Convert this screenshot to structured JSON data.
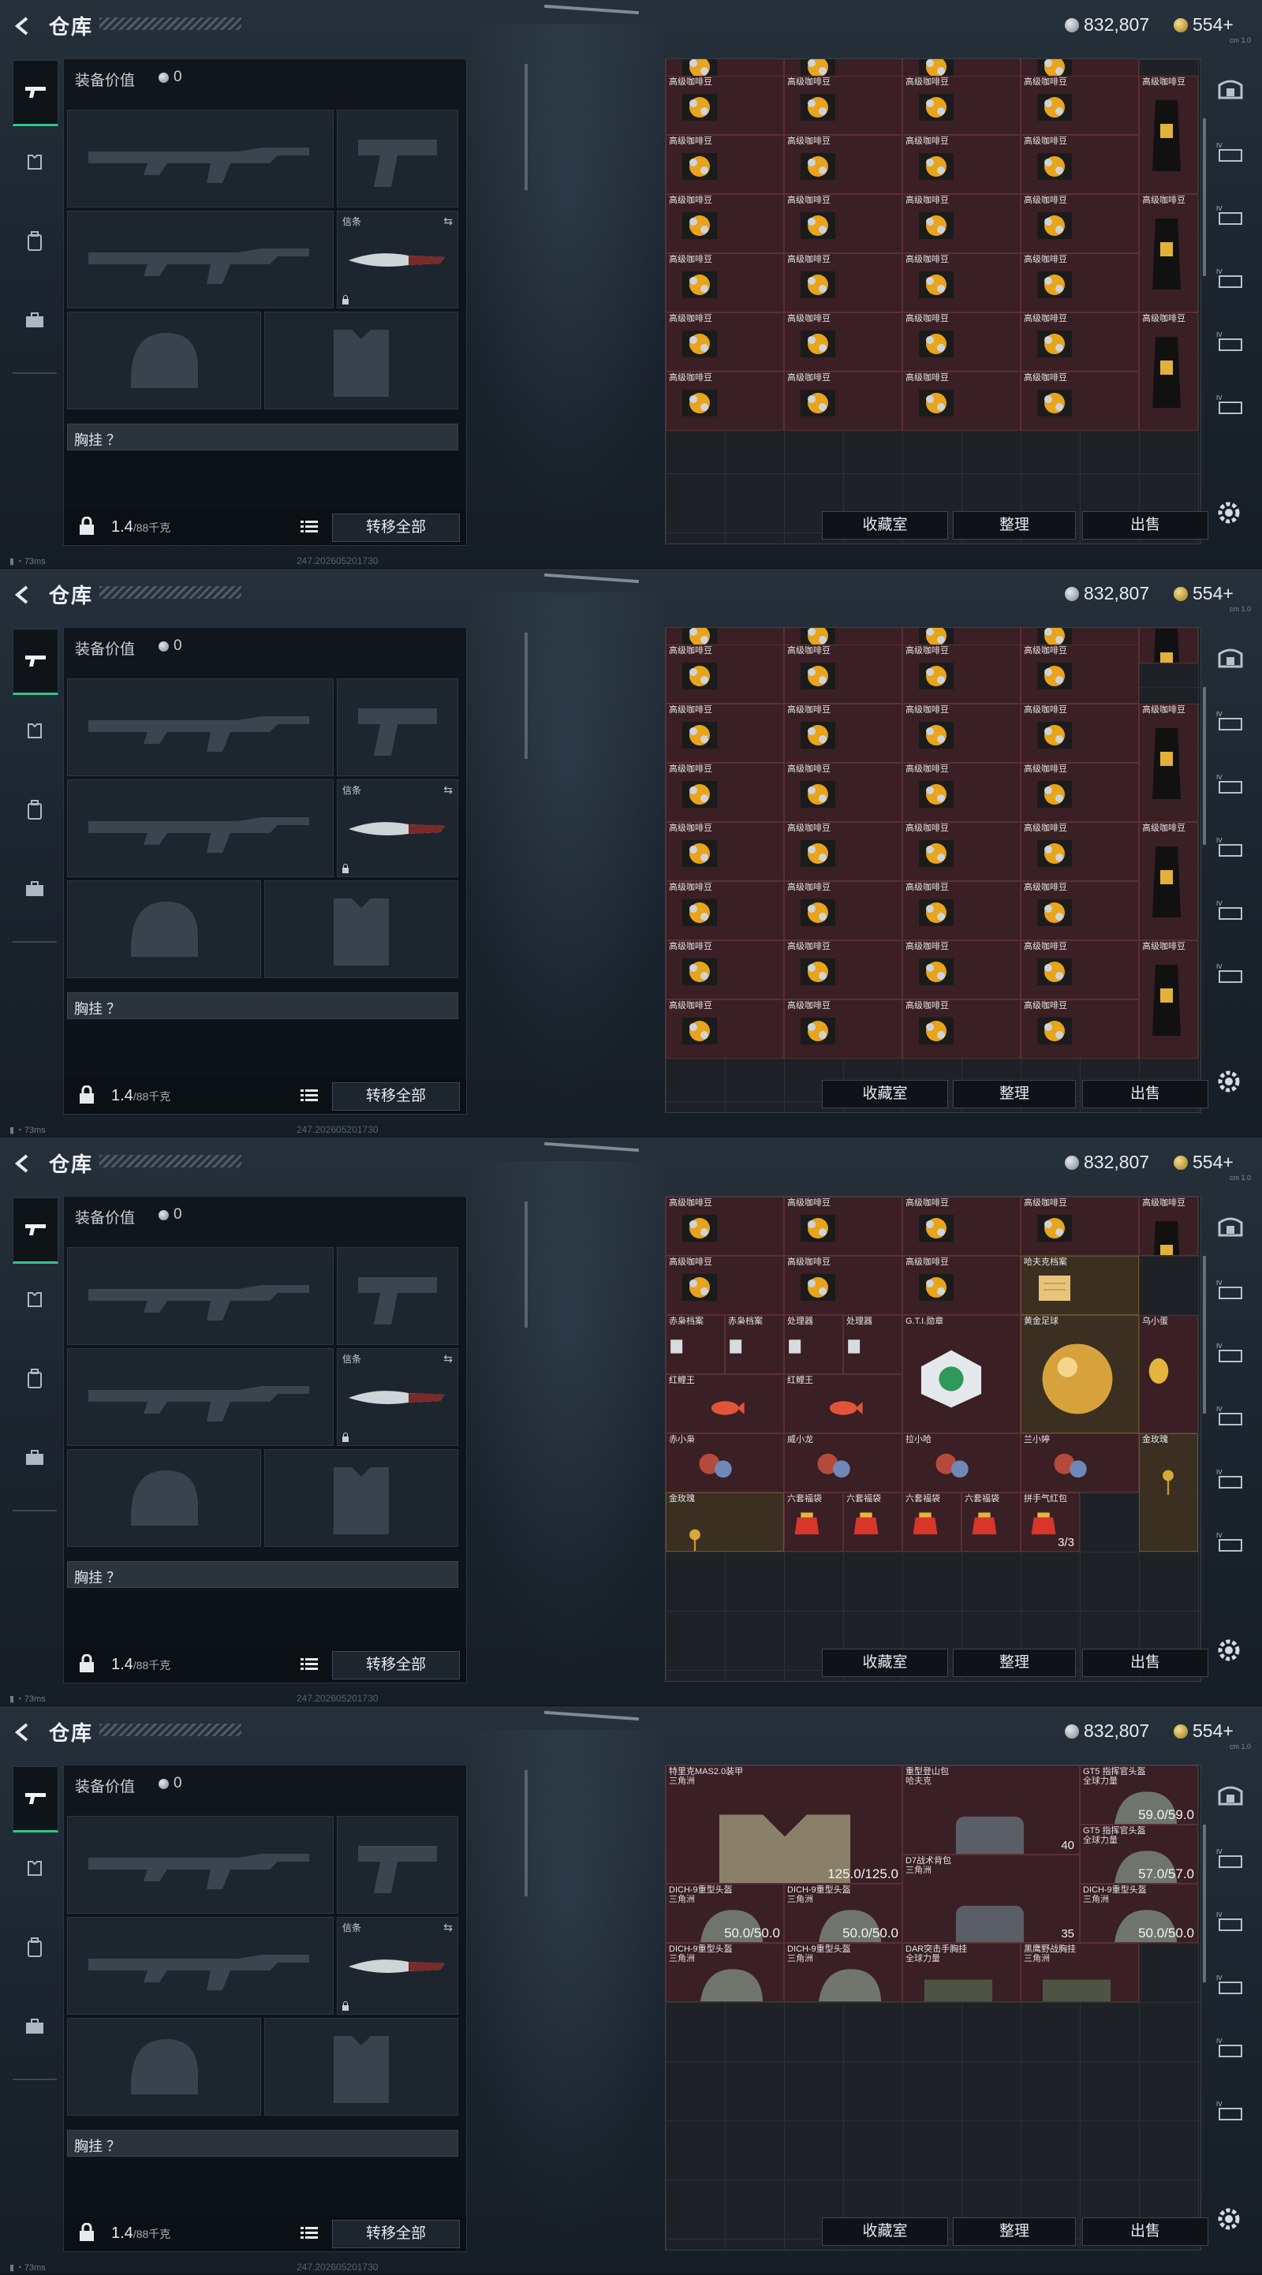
{
  "header": {
    "title": "仓库",
    "silver": "832,807",
    "gold": "554+",
    "mini_label": "cm 1.0"
  },
  "loadout": {
    "value_label": "装备价值",
    "value": "0",
    "melee_label": "信条",
    "chest_label": "胸挂 ？",
    "weight": "1.4",
    "weight_max": "/88千克",
    "transfer_label": "转移全部"
  },
  "status": {
    "ping": "73ms",
    "build": "247.20260520173​0"
  },
  "stash_buttons": {
    "collection": "收藏室",
    "organize": "整理",
    "sell": "出售"
  },
  "frames": [
    {
      "items": [
        {
          "name": "",
          "sub": "",
          "col": 0,
          "row": -0.4,
          "w": 1,
          "h": 1,
          "kind": "bean"
        },
        {
          "name": "",
          "sub": "",
          "col": 1,
          "row": -0.4,
          "w": 1,
          "h": 1,
          "kind": "bean"
        },
        {
          "name": "",
          "sub": "",
          "col": 2,
          "row": -0.4,
          "w": 1,
          "h": 1,
          "kind": "bean"
        },
        {
          "name": "",
          "sub": "",
          "col": 3,
          "row": -0.4,
          "w": 1,
          "h": 1,
          "kind": "bean"
        },
        {
          "name": "高级咖啡豆",
          "col": 0,
          "row": 0.28,
          "w": 1,
          "h": 1,
          "kind": "bean"
        },
        {
          "name": "高级咖啡豆",
          "col": 1,
          "row": 0.28,
          "w": 1,
          "h": 1,
          "kind": "bean"
        },
        {
          "name": "高级咖啡豆",
          "col": 2,
          "row": 0.28,
          "w": 1,
          "h": 1,
          "kind": "bean"
        },
        {
          "name": "高级咖啡豆",
          "col": 3,
          "row": 0.28,
          "w": 1,
          "h": 1,
          "kind": "bean"
        },
        {
          "name": "高级咖啡豆",
          "col": 4,
          "row": 0.28,
          "w": 0.5,
          "h": 2,
          "kind": "bag"
        },
        {
          "name": "高级咖啡豆",
          "col": 0,
          "row": 1.28,
          "w": 1,
          "h": 1,
          "kind": "bean"
        },
        {
          "name": "高级咖啡豆",
          "col": 1,
          "row": 1.28,
          "w": 1,
          "h": 1,
          "kind": "bean"
        },
        {
          "name": "高级咖啡豆",
          "col": 2,
          "row": 1.28,
          "w": 1,
          "h": 1,
          "kind": "bean"
        },
        {
          "name": "高级咖啡豆",
          "col": 3,
          "row": 1.28,
          "w": 1,
          "h": 1,
          "kind": "bean"
        },
        {
          "name": "高级咖啡豆",
          "col": 0,
          "row": 2.28,
          "w": 1,
          "h": 1,
          "kind": "bean"
        },
        {
          "name": "高级咖啡豆",
          "col": 1,
          "row": 2.28,
          "w": 1,
          "h": 1,
          "kind": "bean"
        },
        {
          "name": "高级咖啡豆",
          "col": 2,
          "row": 2.28,
          "w": 1,
          "h": 1,
          "kind": "bean"
        },
        {
          "name": "高级咖啡豆",
          "col": 3,
          "row": 2.28,
          "w": 1,
          "h": 1,
          "kind": "bean"
        },
        {
          "name": "高级咖啡豆",
          "col": 4,
          "row": 2.28,
          "w": 0.5,
          "h": 2,
          "kind": "bag"
        },
        {
          "name": "高级咖啡豆",
          "col": 0,
          "row": 3.28,
          "w": 1,
          "h": 1,
          "kind": "bean"
        },
        {
          "name": "高级咖啡豆",
          "col": 1,
          "row": 3.28,
          "w": 1,
          "h": 1,
          "kind": "bean"
        },
        {
          "name": "高级咖啡豆",
          "col": 2,
          "row": 3.28,
          "w": 1,
          "h": 1,
          "kind": "bean"
        },
        {
          "name": "高级咖啡豆",
          "col": 3,
          "row": 3.28,
          "w": 1,
          "h": 1,
          "kind": "bean"
        },
        {
          "name": "高级咖啡豆",
          "col": 0,
          "row": 4.28,
          "w": 1,
          "h": 1,
          "kind": "bean"
        },
        {
          "name": "高级咖啡豆",
          "col": 1,
          "row": 4.28,
          "w": 1,
          "h": 1,
          "kind": "bean"
        },
        {
          "name": "高级咖啡豆",
          "col": 2,
          "row": 4.28,
          "w": 1,
          "h": 1,
          "kind": "bean"
        },
        {
          "name": "高级咖啡豆",
          "col": 3,
          "row": 4.28,
          "w": 1,
          "h": 1,
          "kind": "bean"
        },
        {
          "name": "高级咖啡豆",
          "col": 4,
          "row": 4.28,
          "w": 0.5,
          "h": 2,
          "kind": "bag"
        },
        {
          "name": "高级咖啡豆",
          "col": 0,
          "row": 5.28,
          "w": 1,
          "h": 1,
          "kind": "bean"
        },
        {
          "name": "高级咖啡豆",
          "col": 1,
          "row": 5.28,
          "w": 1,
          "h": 1,
          "kind": "bean"
        },
        {
          "name": "高级咖啡豆",
          "col": 2,
          "row": 5.28,
          "w": 1,
          "h": 1,
          "kind": "bean"
        },
        {
          "name": "高级咖啡豆",
          "col": 3,
          "row": 5.28,
          "w": 1,
          "h": 1,
          "kind": "bean"
        }
      ]
    },
    {
      "items": [
        {
          "name": "",
          "col": 0,
          "row": -0.4,
          "w": 1,
          "h": 1,
          "kind": "bean"
        },
        {
          "name": "",
          "col": 1,
          "row": -0.4,
          "w": 1,
          "h": 1,
          "kind": "bean"
        },
        {
          "name": "",
          "col": 2,
          "row": -0.4,
          "w": 1,
          "h": 1,
          "kind": "bean"
        },
        {
          "name": "",
          "col": 3,
          "row": -0.4,
          "w": 1,
          "h": 1,
          "kind": "bean"
        },
        {
          "name": "",
          "col": 4,
          "row": -0.4,
          "w": 0.5,
          "h": 1,
          "kind": "bag"
        },
        {
          "name": "高级咖啡豆",
          "col": 0,
          "row": 0.28,
          "w": 1,
          "h": 1,
          "kind": "bean"
        },
        {
          "name": "高级咖啡豆",
          "col": 1,
          "row": 0.28,
          "w": 1,
          "h": 1,
          "kind": "bean"
        },
        {
          "name": "高级咖啡豆",
          "col": 2,
          "row": 0.28,
          "w": 1,
          "h": 1,
          "kind": "bean"
        },
        {
          "name": "高级咖啡豆",
          "col": 3,
          "row": 0.28,
          "w": 1,
          "h": 1,
          "kind": "bean"
        },
        {
          "name": "高级咖啡豆",
          "col": 0,
          "row": 1.28,
          "w": 1,
          "h": 1,
          "kind": "bean"
        },
        {
          "name": "高级咖啡豆",
          "col": 1,
          "row": 1.28,
          "w": 1,
          "h": 1,
          "kind": "bean"
        },
        {
          "name": "高级咖啡豆",
          "col": 2,
          "row": 1.28,
          "w": 1,
          "h": 1,
          "kind": "bean"
        },
        {
          "name": "高级咖啡豆",
          "col": 3,
          "row": 1.28,
          "w": 1,
          "h": 1,
          "kind": "bean"
        },
        {
          "name": "高级咖啡豆",
          "col": 4,
          "row": 1.28,
          "w": 0.5,
          "h": 2,
          "kind": "bag"
        },
        {
          "name": "高级咖啡豆",
          "col": 0,
          "row": 2.28,
          "w": 1,
          "h": 1,
          "kind": "bean"
        },
        {
          "name": "高级咖啡豆",
          "col": 1,
          "row": 2.28,
          "w": 1,
          "h": 1,
          "kind": "bean"
        },
        {
          "name": "高级咖啡豆",
          "col": 2,
          "row": 2.28,
          "w": 1,
          "h": 1,
          "kind": "bean"
        },
        {
          "name": "高级咖啡豆",
          "col": 3,
          "row": 2.28,
          "w": 1,
          "h": 1,
          "kind": "bean"
        },
        {
          "name": "高级咖啡豆",
          "col": 0,
          "row": 3.28,
          "w": 1,
          "h": 1,
          "kind": "bean"
        },
        {
          "name": "高级咖啡豆",
          "col": 1,
          "row": 3.28,
          "w": 1,
          "h": 1,
          "kind": "bean"
        },
        {
          "name": "高级咖啡豆",
          "col": 2,
          "row": 3.28,
          "w": 1,
          "h": 1,
          "kind": "bean"
        },
        {
          "name": "高级咖啡豆",
          "col": 3,
          "row": 3.28,
          "w": 1,
          "h": 1,
          "kind": "bean"
        },
        {
          "name": "高级咖啡豆",
          "col": 4,
          "row": 3.28,
          "w": 0.5,
          "h": 2,
          "kind": "bag"
        },
        {
          "name": "高级咖啡豆",
          "col": 0,
          "row": 4.28,
          "w": 1,
          "h": 1,
          "kind": "bean"
        },
        {
          "name": "高级咖啡豆",
          "col": 1,
          "row": 4.28,
          "w": 1,
          "h": 1,
          "kind": "bean"
        },
        {
          "name": "高级咖啡豆",
          "col": 2,
          "row": 4.28,
          "w": 1,
          "h": 1,
          "kind": "bean"
        },
        {
          "name": "高级咖啡豆",
          "col": 3,
          "row": 4.28,
          "w": 1,
          "h": 1,
          "kind": "bean"
        },
        {
          "name": "高级咖啡豆",
          "col": 0,
          "row": 5.28,
          "w": 1,
          "h": 1,
          "kind": "bean"
        },
        {
          "name": "高级咖啡豆",
          "col": 1,
          "row": 5.28,
          "w": 1,
          "h": 1,
          "kind": "bean"
        },
        {
          "name": "高级咖啡豆",
          "col": 2,
          "row": 5.28,
          "w": 1,
          "h": 1,
          "kind": "bean"
        },
        {
          "name": "高级咖啡豆",
          "col": 3,
          "row": 5.28,
          "w": 1,
          "h": 1,
          "kind": "bean"
        },
        {
          "name": "高级咖啡豆",
          "col": 4,
          "row": 5.28,
          "w": 0.5,
          "h": 2,
          "kind": "bag"
        },
        {
          "name": "高级咖啡豆",
          "col": 0,
          "row": 6.28,
          "w": 1,
          "h": 1,
          "kind": "bean"
        },
        {
          "name": "高级咖啡豆",
          "col": 1,
          "row": 6.28,
          "w": 1,
          "h": 1,
          "kind": "bean"
        },
        {
          "name": "高级咖啡豆",
          "col": 2,
          "row": 6.28,
          "w": 1,
          "h": 1,
          "kind": "bean"
        },
        {
          "name": "高级咖啡豆",
          "col": 3,
          "row": 6.28,
          "w": 1,
          "h": 1,
          "kind": "bean"
        }
      ]
    },
    {
      "items": [
        {
          "name": "高级咖啡豆",
          "col": 0,
          "row": 0,
          "w": 1,
          "h": 1,
          "kind": "bean"
        },
        {
          "name": "高级咖啡豆",
          "col": 1,
          "row": 0,
          "w": 1,
          "h": 1,
          "kind": "bean"
        },
        {
          "name": "高级咖啡豆",
          "col": 2,
          "row": 0,
          "w": 1,
          "h": 1,
          "kind": "bean"
        },
        {
          "name": "高级咖啡豆",
          "col": 3,
          "row": 0,
          "w": 1,
          "h": 1,
          "kind": "bean"
        },
        {
          "name": "高级咖啡豆",
          "col": 4,
          "row": 0,
          "w": 0.5,
          "h": 1,
          "kind": "bag"
        },
        {
          "name": "高级咖啡豆",
          "col": 0,
          "row": 1,
          "w": 1,
          "h": 1,
          "kind": "bean"
        },
        {
          "name": "高级咖啡豆",
          "col": 1,
          "row": 1,
          "w": 1,
          "h": 1,
          "kind": "bean"
        },
        {
          "name": "高级咖啡豆",
          "col": 2,
          "row": 1,
          "w": 1,
          "h": 1,
          "kind": "bean"
        },
        {
          "name": "哈夫克档案",
          "col": 3,
          "row": 1,
          "w": 1,
          "h": 1,
          "kind": "doc"
        },
        {
          "name": "赤枭档案",
          "col": 0,
          "row": 2,
          "w": 0.5,
          "h": 1,
          "kind": "box"
        },
        {
          "name": "赤枭档案",
          "col": 0.5,
          "row": 2,
          "w": 0.5,
          "h": 1,
          "kind": "box"
        },
        {
          "name": "处理器",
          "col": 1,
          "row": 2,
          "w": 0.5,
          "h": 1,
          "kind": "box"
        },
        {
          "name": "处理器",
          "col": 1.5,
          "row": 2,
          "w": 0.5,
          "h": 1,
          "kind": "box"
        },
        {
          "name": "G.T.I.勋章",
          "col": 2,
          "row": 2,
          "w": 1,
          "h": 2,
          "kind": "medal"
        },
        {
          "name": "黄金足球",
          "col": 3,
          "row": 2,
          "w": 1,
          "h": 2,
          "kind": "ball"
        },
        {
          "name": "乌小蛋",
          "col": 4,
          "row": 2,
          "w": 0.5,
          "h": 2,
          "kind": "egg"
        },
        {
          "name": "红鲤王",
          "col": 0,
          "row": 3,
          "w": 1,
          "h": 1,
          "kind": "fish"
        },
        {
          "name": "红鲤王",
          "col": 1,
          "row": 3,
          "w": 1,
          "h": 1,
          "kind": "fish"
        },
        {
          "name": "赤小枭",
          "col": 0,
          "row": 4,
          "w": 1,
          "h": 1,
          "kind": "toy"
        },
        {
          "name": "威小龙",
          "col": 1,
          "row": 4,
          "w": 1,
          "h": 1,
          "kind": "toy"
        },
        {
          "name": "拉小哈",
          "col": 2,
          "row": 4,
          "w": 1,
          "h": 1,
          "kind": "toy"
        },
        {
          "name": "兰小婷",
          "col": 3,
          "row": 4,
          "w": 1,
          "h": 1,
          "kind": "toy"
        },
        {
          "name": "金玫瑰",
          "col": 4,
          "row": 4,
          "w": 0.5,
          "h": 2,
          "kind": "rose"
        },
        {
          "name": "金玫瑰",
          "col": 0,
          "row": 5,
          "w": 1,
          "h": 1,
          "kind": "rose"
        },
        {
          "name": "六套福袋",
          "col": 1,
          "row": 5,
          "w": 0.5,
          "h": 1,
          "kind": "pouch"
        },
        {
          "name": "六套福袋",
          "col": 1.5,
          "row": 5,
          "w": 0.5,
          "h": 1,
          "kind": "pouch"
        },
        {
          "name": "六套福袋",
          "col": 2,
          "row": 5,
          "w": 0.5,
          "h": 1,
          "kind": "pouch"
        },
        {
          "name": "六套福袋",
          "col": 2.5,
          "row": 5,
          "w": 0.5,
          "h": 1,
          "kind": "pouch"
        },
        {
          "name": "拼手气红包",
          "col": 3,
          "row": 5,
          "w": 0.5,
          "h": 1,
          "kind": "pouch",
          "count": "3/3"
        }
      ]
    },
    {
      "items": [
        {
          "name": "特里克MAS2.0装甲",
          "sub": "三角洲",
          "col": 0,
          "row": 0,
          "w": 2,
          "h": 2,
          "kind": "armor",
          "dur": "125.0/125.0"
        },
        {
          "name": "重型登山包",
          "sub": "哈夫克",
          "col": 2,
          "row": 0,
          "w": 1.5,
          "h": 1.5,
          "kind": "pack",
          "count": "40"
        },
        {
          "name": "GT5 指挥官头盔",
          "sub": "全球力量",
          "col": 3.5,
          "row": 0,
          "w": 1,
          "h": 1,
          "kind": "helmet",
          "dur": "59.0/59.0"
        },
        {
          "name": "GT5 指挥官头盔",
          "sub": "全球力量",
          "col": 3.5,
          "row": 1,
          "w": 1,
          "h": 1,
          "kind": "helmet",
          "dur": "57.0/57.0"
        },
        {
          "name": "D7战术背包",
          "sub": "三角洲",
          "col": 2,
          "row": 1.5,
          "w": 1.5,
          "h": 1.5,
          "kind": "pack",
          "count": "35"
        },
        {
          "name": "DICH-9重型头盔",
          "sub": "三角洲",
          "col": 0,
          "row": 2,
          "w": 1,
          "h": 1,
          "kind": "helmet",
          "dur": "50.0/50.0"
        },
        {
          "name": "DICH-9重型头盔",
          "sub": "三角洲",
          "col": 1,
          "row": 2,
          "w": 1,
          "h": 1,
          "kind": "helmet",
          "dur": "50.0/50.0"
        },
        {
          "name": "DICH-9重型头盔",
          "sub": "三角洲",
          "col": 3.5,
          "row": 2,
          "w": 1,
          "h": 1,
          "kind": "helmet",
          "dur": "50.0/50.0"
        },
        {
          "name": "DICH-9重型头盔",
          "sub": "三角洲",
          "col": 0,
          "row": 3,
          "w": 1,
          "h": 1,
          "kind": "helmet"
        },
        {
          "name": "DICH-9重型头盔",
          "sub": "三角洲",
          "col": 1,
          "row": 3,
          "w": 1,
          "h": 1,
          "kind": "helmet"
        },
        {
          "name": "DAR突击手胸挂",
          "sub": "全球力量",
          "col": 2,
          "row": 3,
          "w": 1,
          "h": 1,
          "kind": "rig"
        },
        {
          "name": "黑鹰野战胸挂",
          "sub": "三角洲",
          "col": 3,
          "row": 3,
          "w": 1,
          "h": 1,
          "kind": "rig"
        }
      ]
    }
  ]
}
